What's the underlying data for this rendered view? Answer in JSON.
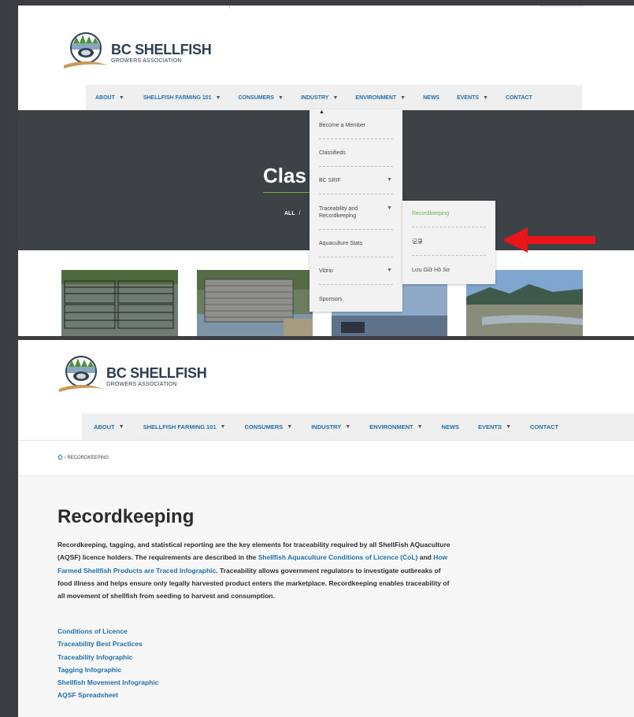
{
  "top": {
    "logo": {
      "line1": "BC SHELLFISH",
      "line2": "GROWERS ASSOCIATION"
    },
    "nav": [
      {
        "label": "ABOUT",
        "caret": "▼"
      },
      {
        "label": "SHELLFISH FARMING 101",
        "caret": "▼"
      },
      {
        "label": "CONSUMERS",
        "caret": "▼"
      },
      {
        "label": "INDUSTRY",
        "caret": "▼"
      },
      {
        "label": "ENVIRONMENT",
        "caret": "▼"
      },
      {
        "label": "NEWS",
        "caret": ""
      },
      {
        "label": "EVENTS",
        "caret": "▼"
      },
      {
        "label": "CONTACT",
        "caret": ""
      }
    ],
    "hero": {
      "title": "Clas",
      "filter_all": "ALL",
      "filter_sep": "/"
    },
    "dropdown": [
      {
        "label": "Become a Member"
      },
      {
        "label": "Classifieds"
      },
      {
        "label": "BC SRIF",
        "caret": "▼"
      },
      {
        "label": "Traceability and Recordkeeping",
        "caret": "▼"
      },
      {
        "label": "Aquaculture Stats"
      },
      {
        "label": "Vibrio",
        "caret": "▼"
      },
      {
        "label": "Sponsors"
      }
    ],
    "submenu": [
      {
        "label": "Recordkeeping"
      },
      {
        "label": "记录"
      },
      {
        "label": "Lưu Giữ Hồ Sơ"
      }
    ],
    "colors": {
      "accent_green": "#6db33f",
      "link_blue": "#1f6fae",
      "hero_bg": "#3d4247",
      "arrow_red": "#e8151b"
    }
  },
  "bottom": {
    "logo": {
      "line1": "BC SHELLFISH",
      "line2": "GROWERS ASSOCIATION"
    },
    "nav": [
      {
        "label": "ABOUT",
        "caret": "▼"
      },
      {
        "label": "SHELLFISH FARMING 101",
        "caret": "▼"
      },
      {
        "label": "CONSUMERS",
        "caret": "▼"
      },
      {
        "label": "INDUSTRY",
        "caret": "▼"
      },
      {
        "label": "ENVIRONMENT",
        "caret": "▼"
      },
      {
        "label": "NEWS",
        "caret": ""
      },
      {
        "label": "EVENTS",
        "caret": "▼"
      },
      {
        "label": "CONTACT",
        "caret": ""
      }
    ],
    "breadcrumb": {
      "sep": "›",
      "current": "RECORDKEEPING"
    },
    "page_title": "Recordkeeping",
    "paragraph": {
      "p1": "Recordkeeping, tagging, and statistical reporting are the key elements for traceability required by all ShellFish AQuaculture (AQSF) licence holders. The requirements are described in the ",
      "link1": "Shellfish Aquaculture Conditions of Licence (CoL)",
      "p2": " and ",
      "link2": "How Farmed Shellfish Products are Traced Infographic",
      "p3": ". Traceability allows government regulators to investigate outbreaks of food illness and helps ensure only legally harvested product enters the marketplace. Recordkeeping enables traceability of all movement of shellfish from seeding to harvest and consumption."
    },
    "links": [
      "Conditions of Licence",
      "Traceability Best Practices",
      "Traceability Infographic",
      "Tagging Infographic",
      "Shellfish Movement Infographic",
      "AQSF Spreadsheet"
    ]
  }
}
